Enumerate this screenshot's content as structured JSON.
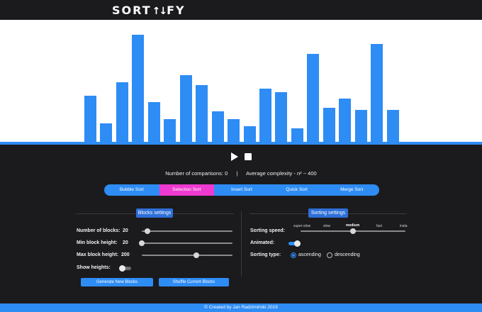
{
  "app": {
    "logo_left": "SORT",
    "logo_arrows": "↑↓",
    "logo_right": "FY"
  },
  "bars": {
    "color": "#2e8cf5",
    "values": [
      94,
      38,
      122,
      219,
      82,
      47,
      136,
      117,
      63,
      46,
      32,
      109,
      102,
      28,
      180,
      70,
      89,
      66,
      201,
      65
    ]
  },
  "controls": {
    "play_label": "Play",
    "stop_label": "Stop"
  },
  "stats": {
    "comparisons_label": "Number of comparisons:",
    "comparisons_value": "0",
    "separator": "|",
    "complexity_label": "Average complexity -",
    "complexity_value": "n² ~ 400"
  },
  "algorithms": [
    {
      "label": "Bubble Sort",
      "active": false
    },
    {
      "label": "Selection Sort",
      "active": true
    },
    {
      "label": "Insert Sort",
      "active": false
    },
    {
      "label": "Quick Sort",
      "active": false
    },
    {
      "label": "Merge Sort",
      "active": false
    }
  ],
  "blocks_settings": {
    "title": "Blocks settings",
    "number_of_blocks": {
      "label": "Number of blocks:",
      "value": "20",
      "fraction": 0.06
    },
    "min_block_height": {
      "label": "Min block height:",
      "value": "20",
      "fraction": 0.0
    },
    "max_block_height": {
      "label": "Max block height:",
      "value": "200",
      "fraction": 0.6
    },
    "show_heights": {
      "label": "Show heights:",
      "on": false
    },
    "generate_button": "Generate New Blocks",
    "shuffle_button": "Shuffle Current Blocks"
  },
  "sorting_settings": {
    "title": "Sorting settings",
    "speed": {
      "label": "Sorting speed:",
      "ticks": [
        "super-slow",
        "slow",
        "medium",
        "fast",
        "insta"
      ],
      "selected": "medium",
      "fraction": 0.5
    },
    "animated": {
      "label": "Animated:",
      "on": true
    },
    "type": {
      "label": "Sorting type:",
      "options": [
        "ascending",
        "descending"
      ],
      "selected": "ascending"
    }
  },
  "footer": {
    "text": "© Created by Jan Radzimiński 2019"
  },
  "colors": {
    "accent": "#2e8cf5",
    "active_algo": "#ee3ad0",
    "background": "#1b1b1d"
  }
}
